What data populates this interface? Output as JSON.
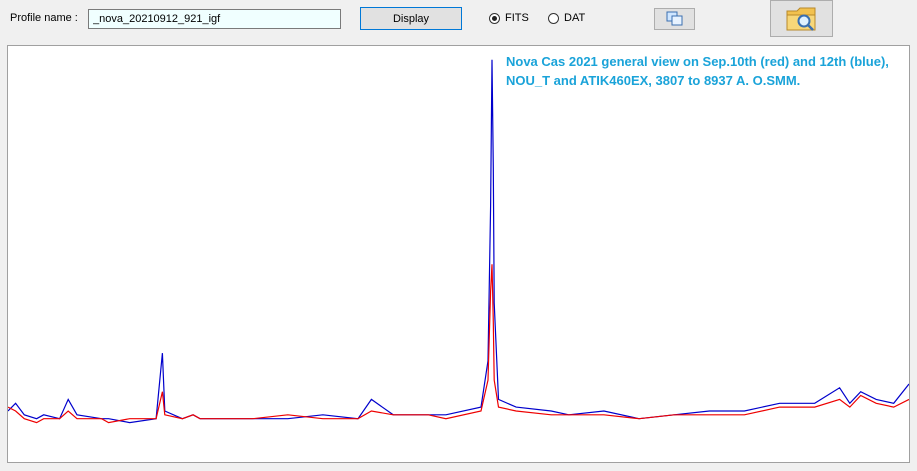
{
  "toolbar": {
    "profile_label": "Profile name :",
    "profile_value": "_nova_20210912_921_igf",
    "display_label": "Display",
    "format_options": [
      {
        "label": "FITS",
        "selected": true
      },
      {
        "label": "DAT",
        "selected": false
      }
    ],
    "copy_icon": "copy-windows-icon",
    "browse_icon": "folder-magnifier-icon"
  },
  "chart_data": {
    "type": "line",
    "title": "Nova Cas 2021 general view  on Sep.10th (red) and 12th (blue), NOU_T and ATIK460EX, 3807 to 8937 A.    O.SMM.",
    "xlabel": "",
    "ylabel": "",
    "xlim": [
      3807,
      8937
    ],
    "ylim": [
      0,
      1
    ],
    "grid": false,
    "series": [
      {
        "color": "#0000cc",
        "x": [
          3807,
          3850,
          3900,
          3970,
          4010,
          4101,
          4150,
          4200,
          4340,
          4380,
          4500,
          4650,
          4686,
          4700,
          4800,
          4861,
          4900,
          5000,
          5200,
          5400,
          5600,
          5800,
          5876,
          6000,
          6200,
          6300,
          6500,
          6540,
          6555,
          6563,
          6570,
          6575,
          6600,
          6700,
          6900,
          7000,
          7200,
          7400,
          7600,
          7800,
          8000,
          8200,
          8400,
          8542,
          8600,
          8662,
          8750,
          8850,
          8937
        ],
        "values": [
          0.07,
          0.09,
          0.06,
          0.05,
          0.06,
          0.05,
          0.1,
          0.06,
          0.05,
          0.05,
          0.04,
          0.05,
          0.22,
          0.07,
          0.05,
          0.06,
          0.05,
          0.05,
          0.05,
          0.05,
          0.06,
          0.05,
          0.1,
          0.06,
          0.06,
          0.06,
          0.08,
          0.2,
          0.6,
          0.98,
          0.7,
          0.35,
          0.1,
          0.08,
          0.07,
          0.06,
          0.07,
          0.05,
          0.06,
          0.07,
          0.07,
          0.09,
          0.09,
          0.13,
          0.09,
          0.12,
          0.1,
          0.09,
          0.14
        ]
      },
      {
        "color": "#ee0000",
        "x": [
          3807,
          3850,
          3900,
          3970,
          4010,
          4101,
          4150,
          4200,
          4340,
          4380,
          4500,
          4650,
          4686,
          4700,
          4800,
          4861,
          4900,
          5000,
          5200,
          5400,
          5600,
          5800,
          5876,
          6000,
          6200,
          6300,
          6500,
          6540,
          6555,
          6563,
          6570,
          6575,
          6600,
          6700,
          6900,
          7000,
          7200,
          7400,
          7600,
          7800,
          8000,
          8200,
          8400,
          8542,
          8600,
          8662,
          8750,
          8850,
          8937
        ],
        "values": [
          0.08,
          0.07,
          0.05,
          0.04,
          0.05,
          0.05,
          0.07,
          0.05,
          0.05,
          0.04,
          0.05,
          0.05,
          0.12,
          0.06,
          0.05,
          0.06,
          0.05,
          0.05,
          0.05,
          0.06,
          0.05,
          0.05,
          0.07,
          0.06,
          0.06,
          0.05,
          0.07,
          0.15,
          0.38,
          0.45,
          0.3,
          0.15,
          0.08,
          0.07,
          0.06,
          0.06,
          0.06,
          0.05,
          0.06,
          0.06,
          0.06,
          0.08,
          0.08,
          0.1,
          0.08,
          0.11,
          0.09,
          0.08,
          0.1
        ]
      }
    ]
  }
}
